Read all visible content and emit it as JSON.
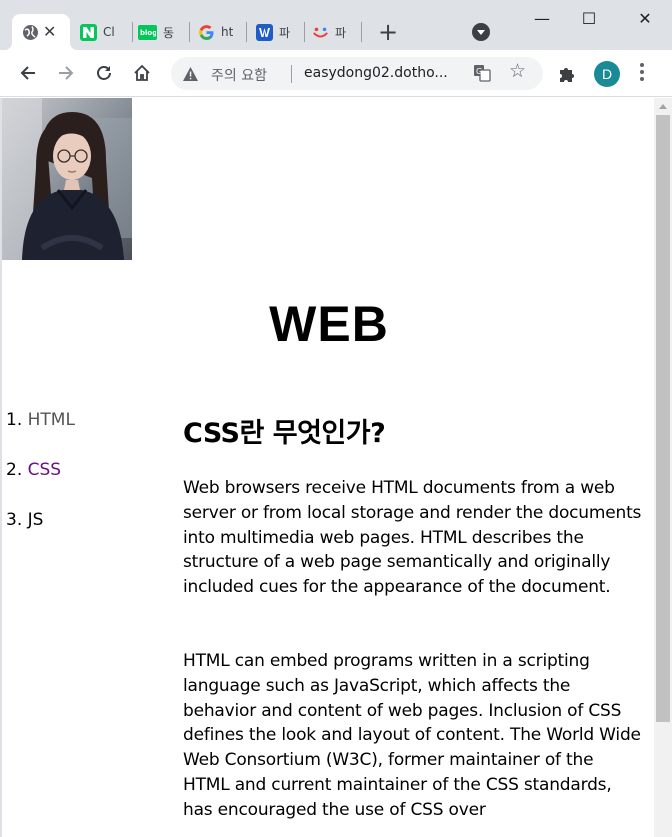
{
  "browser": {
    "tabs": [
      {
        "title": "",
        "favicon": "globe-icon",
        "active": true
      },
      {
        "title": "Cl",
        "favicon": "naver-icon"
      },
      {
        "title": "동",
        "favicon": "naver-blog-icon"
      },
      {
        "title": "ht",
        "favicon": "google-icon"
      },
      {
        "title": "파",
        "favicon": "w-icon"
      },
      {
        "title": "파",
        "favicon": "smile-icon"
      }
    ],
    "new_tab_label": "+",
    "window": {
      "minimize": "—",
      "maximize": "☐",
      "close": "✕"
    },
    "toolbar": {
      "security_label": "주의 요함",
      "url": "easydong02.dotho...",
      "profile_initial": "D"
    }
  },
  "page": {
    "title": "WEB",
    "nav": [
      {
        "num": "1.",
        "label": "HTML"
      },
      {
        "num": "2.",
        "label": "CSS"
      },
      {
        "num": "3.",
        "label": "JS"
      }
    ],
    "article": {
      "heading": "CSS란 무엇인가?",
      "paragraphs": [
        "Web browsers receive HTML documents from a web server or from local storage and render the documents into multimedia web pages. HTML describes the structure of a web page semantically and originally included cues for the appearance of the document.",
        "HTML can embed programs written in a scripting language such as JavaScript, which affects the behavior and content of web pages. Inclusion of CSS defines the look and layout of content. The World Wide Web Consortium (W3C), former maintainer of the HTML and current maintainer of the CSS standards, has encouraged the use of CSS over"
      ]
    }
  },
  "colors": {
    "tabstrip_bg": "#dee1e6",
    "visited_link": "#6b0f83",
    "link": "#555555",
    "avatar": "#1a8a97"
  }
}
